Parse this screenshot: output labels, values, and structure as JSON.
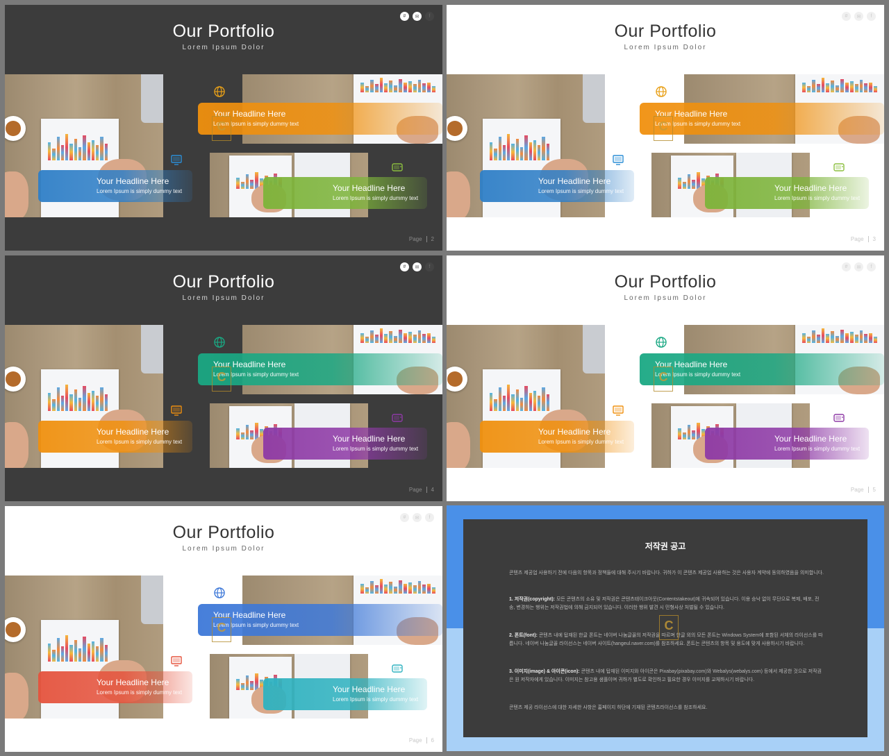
{
  "slides": [
    {
      "title": "Our Portfolio",
      "subtitle": "Lorem Ipsum Dolor",
      "page_label": "Page",
      "page_number": "2",
      "theme": "dark",
      "banner_top": {
        "headline": "Your Headline Here",
        "text": "Lorem Ipsum is simply dummy text",
        "color": "#f0900e"
      },
      "banner_left": {
        "headline": "Your Headline Here",
        "text": "Lorem Ipsum is simply dummy text",
        "color": "#2f7fc7"
      },
      "banner_right": {
        "headline": "Your Headline Here",
        "text": "Lorem Ipsum is simply dummy text",
        "color": "#7db43a"
      },
      "icons": {
        "globe": "#e8a018",
        "monitor": "#2b8ed6",
        "tv": "#8cbf3f"
      }
    },
    {
      "title": "Our Portfolio",
      "subtitle": "Lorem Ipsum Dolor",
      "page_label": "Page",
      "page_number": "3",
      "theme": "light",
      "banner_top": {
        "headline": "Your Headline Here",
        "text": "Lorem Ipsum is simply dummy text",
        "color": "#f0900e"
      },
      "banner_left": {
        "headline": "Your Headline Here",
        "text": "Lorem Ipsum is simply dummy text",
        "color": "#2f7fc7"
      },
      "banner_right": {
        "headline": "Your Headline Here",
        "text": "Lorem Ipsum is simply dummy text",
        "color": "#7db43a"
      },
      "icons": {
        "globe": "#e8a018",
        "monitor": "#2b8ed6",
        "tv": "#8cbf3f"
      }
    },
    {
      "title": "Our Portfolio",
      "subtitle": "Lorem Ipsum Dolor",
      "page_label": "Page",
      "page_number": "4",
      "theme": "dark",
      "banner_top": {
        "headline": "Your Headline Here",
        "text": "Lorem Ipsum is simply dummy text",
        "color": "#1aa883"
      },
      "banner_left": {
        "headline": "Your Headline Here",
        "text": "Lorem Ipsum is simply dummy text",
        "color": "#f0900e"
      },
      "banner_right": {
        "headline": "Your Headline Here",
        "text": "Lorem Ipsum is simply dummy text",
        "color": "#8e3aa6"
      },
      "icons": {
        "globe": "#1aa883",
        "monitor": "#f0900e",
        "tv": "#8e3aa6"
      }
    },
    {
      "title": "Our Portfolio",
      "subtitle": "Lorem Ipsum Dolor",
      "page_label": "Page",
      "page_number": "5",
      "theme": "light",
      "banner_top": {
        "headline": "Your Headline Here",
        "text": "Lorem Ipsum is simply dummy text",
        "color": "#1aa883"
      },
      "banner_left": {
        "headline": "Your Headline Here",
        "text": "Lorem Ipsum is simply dummy text",
        "color": "#f0900e"
      },
      "banner_right": {
        "headline": "Your Headline Here",
        "text": "Lorem Ipsum is simply dummy text",
        "color": "#8e3aa6"
      },
      "icons": {
        "globe": "#1aa883",
        "monitor": "#f0900e",
        "tv": "#8e3aa6"
      }
    },
    {
      "title": "Our Portfolio",
      "subtitle": "Lorem Ipsum Dolor",
      "page_label": "Page",
      "page_number": "6",
      "theme": "light",
      "banner_top": {
        "headline": "Your Headline Here",
        "text": "Lorem Ipsum is simply dummy text",
        "color": "#3d78d8"
      },
      "banner_left": {
        "headline": "Your Headline Here",
        "text": "Lorem Ipsum is simply dummy text",
        "color": "#e5533d"
      },
      "banner_right": {
        "headline": "Your Headline Here",
        "text": "Lorem Ipsum is simply dummy text",
        "color": "#2fb2c0"
      },
      "icons": {
        "globe": "#3d78d8",
        "monitor": "#e5533d",
        "tv": "#2fb2c0"
      }
    }
  ],
  "notice": {
    "title": "저작권 공고",
    "intro": "콘텐츠 제공업 사용하기 전에 다음의 항목과 정책들에 대해 주시기 바랍니다. 귀하가 이 콘텐츠 제공업 사용하는 것은 사용자 계약에 동의하였음을 의미합니다.",
    "p1_label": "1. 저작권(copyright):",
    "p1": "모든 콘텐츠의 소유 및 저작권은 콘텐츠테이크아웃(Contentstakeout)에 귀속되어 있습니다. 이용 승낙 없이 무단으로 복제, 배포, 전송, 변경하는 행위는 저작권법에 의해 금지되어 있습니다. 이러한 행위 발견 시 민형사상 처벌될 수 있습니다.",
    "p2_label": "2. 폰트(font):",
    "p2": "콘텐츠 내에 탑재된 한글 폰트는 네이버 나눔글꼴의 저작권을 따르며 한글 외의 모든 폰트는 Windows System에 포함된 서체의 라이선스를 따릅니다. 네이버 나눔글꼴 라이선스는 네이버 사이트(hangeul.naver.com)를 참조하세요. 폰트는 콘텐츠의 항목 및 용도에 맞게 사용하시기 바랍니다.",
    "p3_label": "3. 이미지(image) & 아이콘(icon):",
    "p3": "콘텐츠 내에 탑재된 이미지와 아이콘은 Pixabay(pixabay.com)와 Webalys(webalys.com) 등에서 제공한 것으로 저작권은 원 저작자에게 있습니다. 이미지는 참고용 샘플이며 귀하가 별도로 확인하고 필요한 경우 이미지를 교체하시기 바랍니다.",
    "outro": "콘텐츠 제공 라이선스에 대한 자세한 사항은 홈페이지 하단에 기재된 콘텐츠라이선스를 참조하세요."
  },
  "watermark": "C"
}
